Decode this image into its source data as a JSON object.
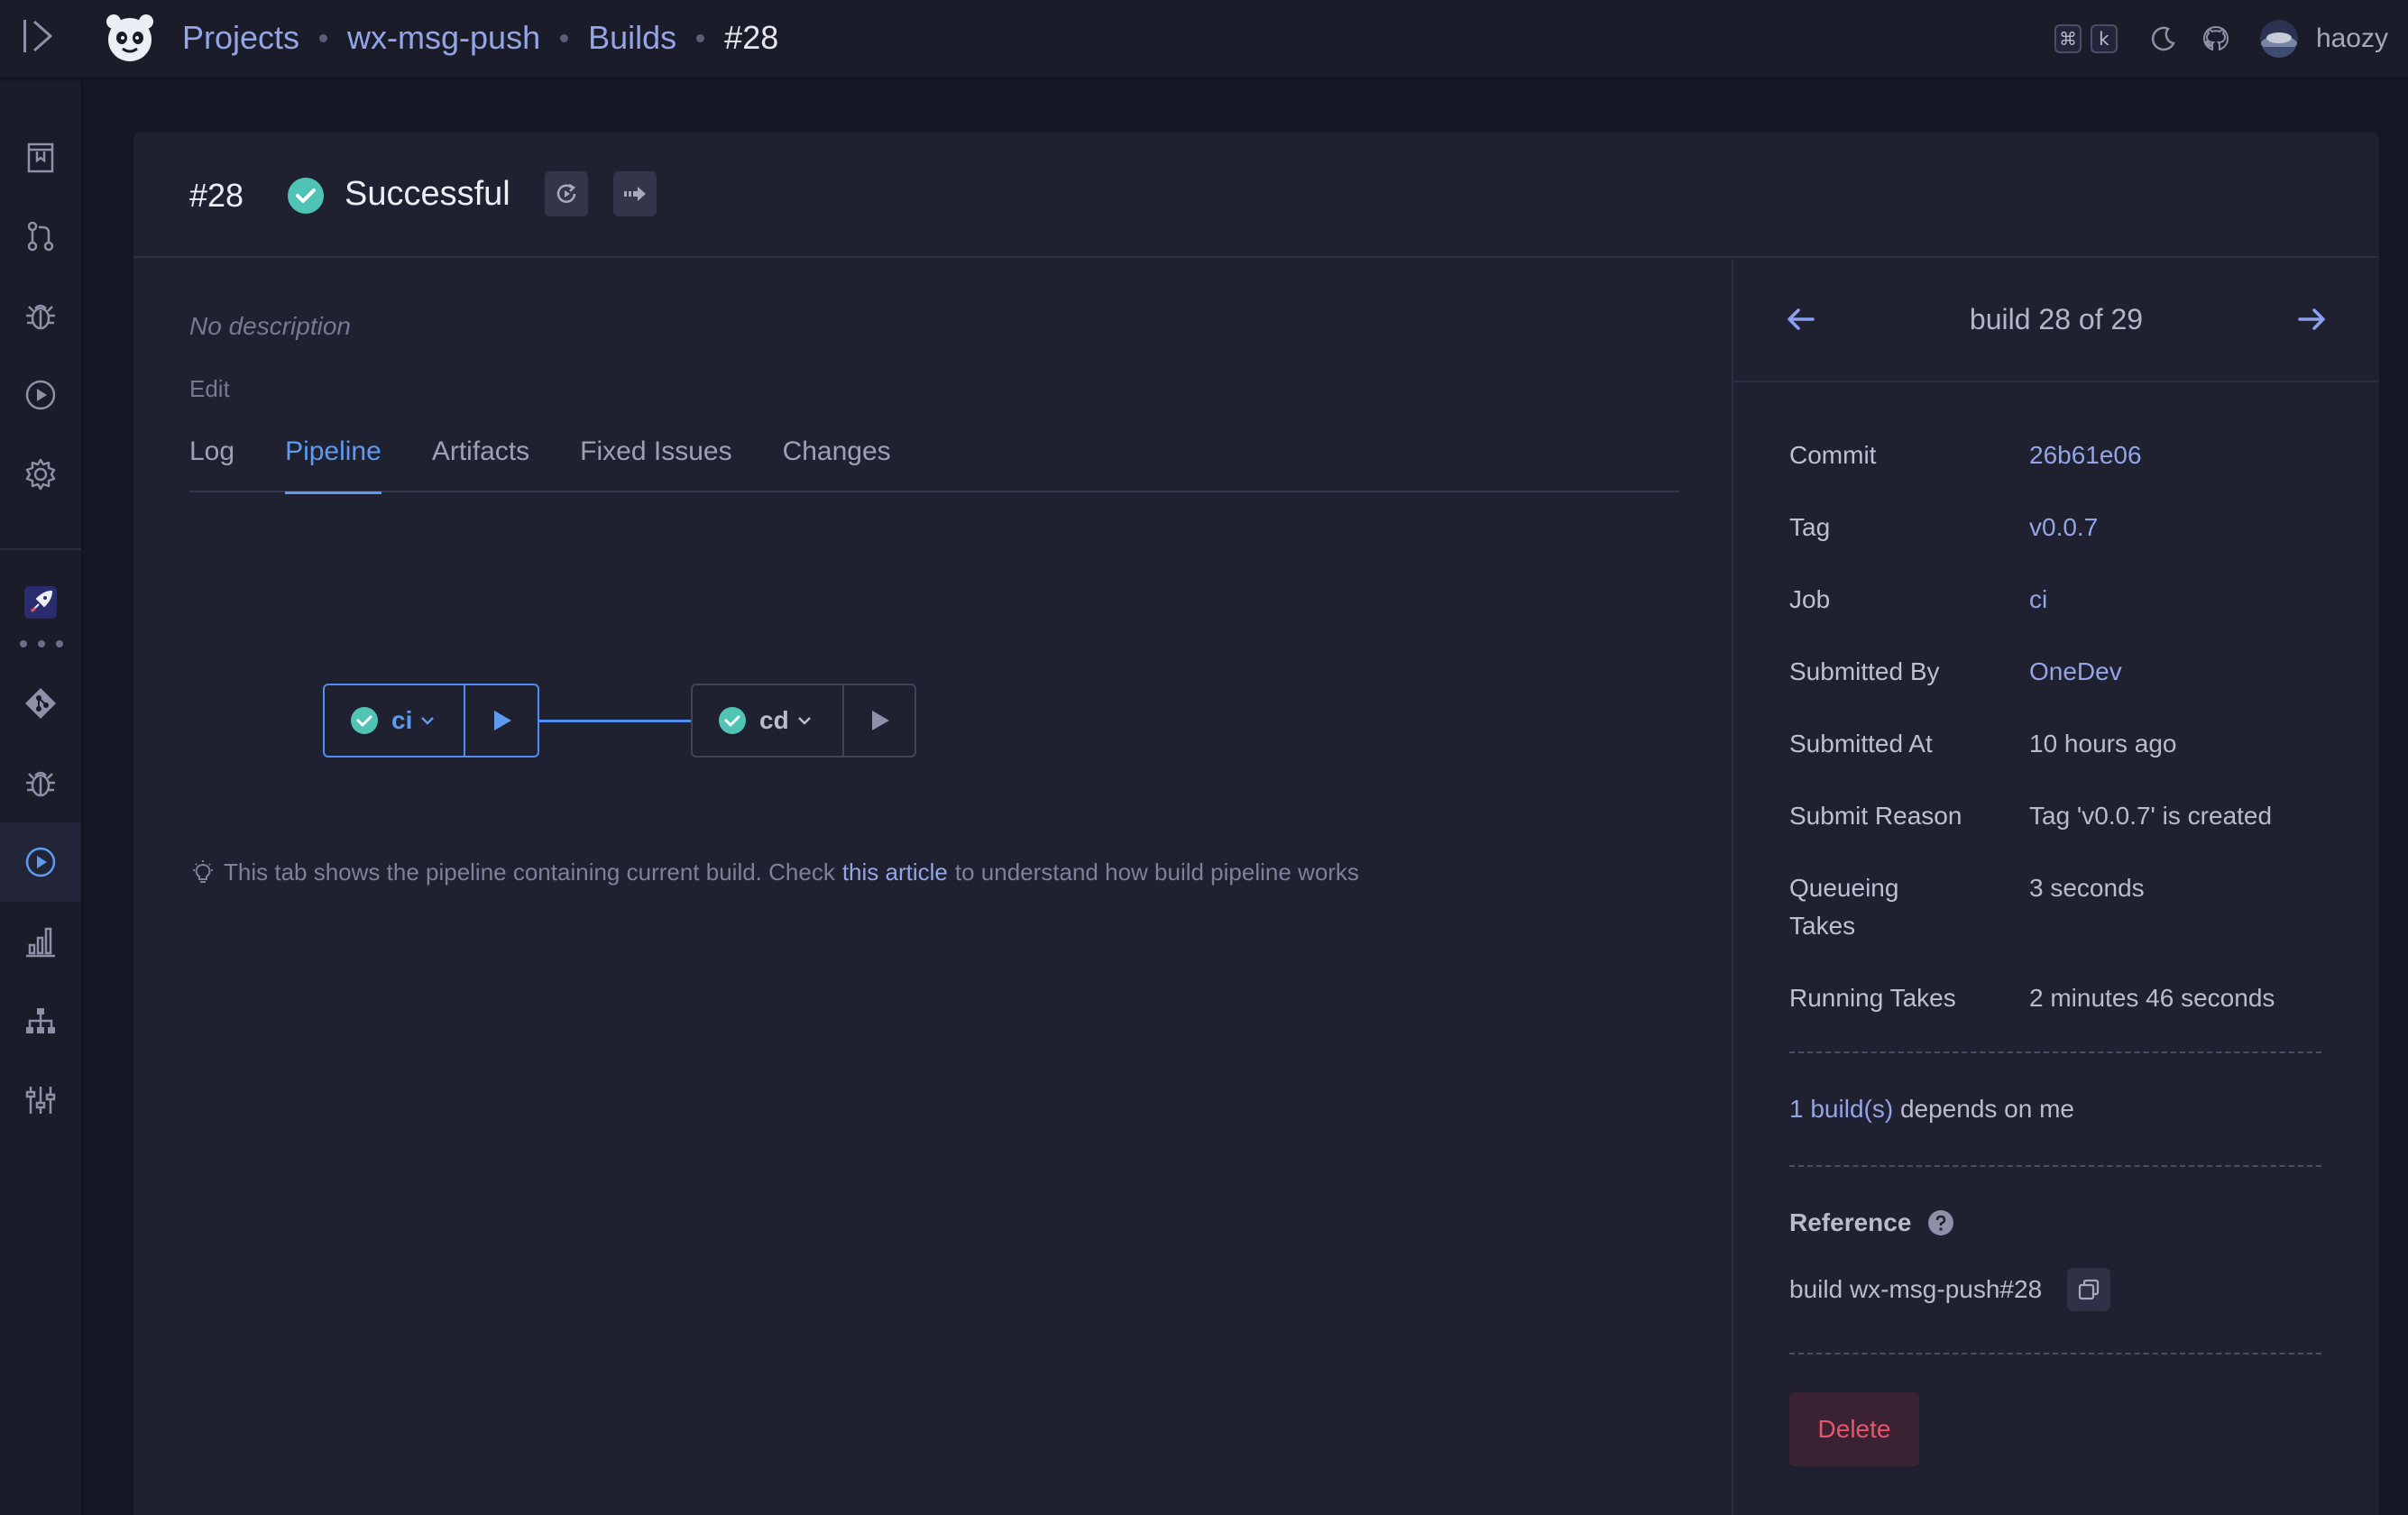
{
  "breadcrumb": {
    "projects": "Projects",
    "project": "wx-msg-push",
    "builds": "Builds",
    "current": "#28"
  },
  "topbar": {
    "kbd_cmd": "⌘",
    "kbd_k": "k",
    "username": "haozy"
  },
  "header": {
    "build_number": "#28",
    "status": "Successful"
  },
  "description": {
    "text": "No description",
    "edit_label": "Edit"
  },
  "tabs": [
    "Log",
    "Pipeline",
    "Artifacts",
    "Fixed Issues",
    "Changes"
  ],
  "active_tab": "Pipeline",
  "pipeline": {
    "nodes": [
      {
        "label": "ci",
        "status": "successful",
        "selected": true
      },
      {
        "label": "cd",
        "status": "successful",
        "selected": false
      }
    ],
    "tip_before": "This tab shows the pipeline containing current build. Check",
    "tip_link": "this article",
    "tip_after": "to understand how build pipeline works"
  },
  "nav": {
    "text": "build 28 of 29"
  },
  "properties": {
    "commit_key": "Commit",
    "commit_val": "26b61e06",
    "tag_key": "Tag",
    "tag_val": "v0.0.7",
    "job_key": "Job",
    "job_val": "ci",
    "submitted_by_key": "Submitted By",
    "submitted_by_val": "OneDev",
    "submitted_at_key": "Submitted At",
    "submitted_at_val": "10 hours ago",
    "submit_reason_key": "Submit Reason",
    "submit_reason_val": "Tag 'v0.0.7' is created",
    "queueing_key": "Queueing Takes",
    "queueing_val": "3 seconds",
    "running_key": "Running Takes",
    "running_val": "2 minutes 46 seconds"
  },
  "depends": {
    "link": "1 build(s)",
    "text": "depends on me"
  },
  "reference": {
    "title": "Reference",
    "value": "build wx-msg-push#28"
  },
  "delete_label": "Delete",
  "colors": {
    "accent": "#5e9bf0",
    "link": "#93a5e6",
    "success": "#4fc3b4",
    "danger": "#e5566a",
    "background": "#161724",
    "card": "#1f2030"
  }
}
